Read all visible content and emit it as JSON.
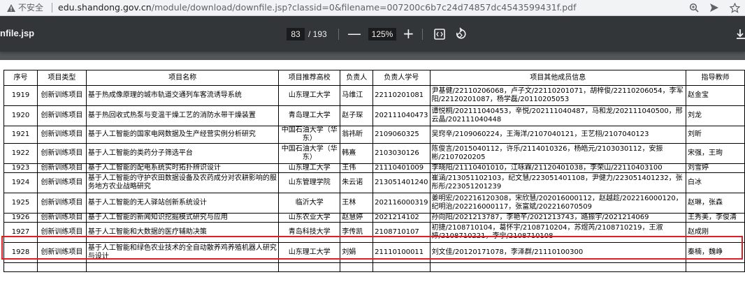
{
  "browser": {
    "security_label": "不安全",
    "url_host": "edu.shandong.gov.cn",
    "url_path": "/module/download/downfile.jsp?classid=0&filename=007200c6b7c24d74857dc4543599431f.pdf",
    "icons": [
      "warning-icon",
      "zoom-icon",
      "share-icon",
      "star-icon"
    ]
  },
  "pdf_toolbar": {
    "title": "nfile.jsp",
    "current_page": "83",
    "total_pages": "/ 193",
    "zoom": "125%",
    "minus": "—",
    "plus": "+",
    "icons": [
      "fit-page-icon",
      "rotate-icon",
      "download-icon"
    ]
  },
  "table": {
    "headers": [
      "序号",
      "项目类型",
      "项目名称",
      "项目推荐高校",
      "负责人",
      "负责人学号",
      "项目其他成员信息",
      "指导教师"
    ],
    "rows": [
      {
        "no": "1919",
        "type": "创新训练项目",
        "name": "基于热成像原理的城市轨道交通列车客流诱导系统",
        "school": "山东理工大学",
        "leader": "马维江",
        "sid": "22110201081",
        "members": "尹基健/22110206068，卢子文/22110201071，胡梓俊/22110206054，李军阳/22120201087，杨学磊/20110205053",
        "advisor": "赵金宝"
      },
      {
        "no": "1920",
        "type": "创新训练项目",
        "name": "基于热回收式热泵与变温干燥工艺的消防水带干燥装置",
        "school": "青岛理工大学",
        "leader": "赵子琛",
        "sid": "202111040473",
        "members": "谭悦桐/202111040453，辛悦/202111040487，马和龙/202111040500，邢云晶/202111040448",
        "advisor": "刘龙"
      },
      {
        "no": "1921",
        "type": "创新训练项目",
        "name": "基于人工智能的国家电网数据及生产经营实例分析研究",
        "school": "中国石油大学（华东）",
        "leader": "翁祎昕",
        "sid": "2109060325",
        "members": "吴窍辛/2109060224，王海洋/2107040121，王艺栩/2107040123",
        "advisor": "刘昕"
      },
      {
        "no": "1922",
        "type": "创新训练项目",
        "name": "基于人工智能的类药分子筛选平台",
        "school": "中国石油大学（华东）",
        "leader": "韩熹",
        "sid": "2103030126",
        "members": "陈俊言/2015040112，许乐/2114010326，杨皓元/2103030112，安振彬/2107020205",
        "advisor": "宋强，王珣"
      },
      {
        "no": "1923",
        "type": "创新训练项目",
        "name": "基于人工智能的配电系统实时拓扑辨识设计",
        "school": "山东理工大学",
        "leader": "王伟",
        "sid": "21110401009",
        "members": "李晓阳/21110401010，江咏霖/21120401038，李荣山/22110403100",
        "advisor": "刘雪婷"
      },
      {
        "no": "1924",
        "type": "创新训练项目",
        "name": "基于人工智能的守护农田数据设备及农药成分对农耕影响的服务地方农业战略研究",
        "school": "山东管理学院",
        "leader": "朱云诺",
        "sid": "213051401240",
        "members": "崔涵/213051102103，纪文慧/223051401108，尹健力/223051401232，张彤彤/223051201239",
        "advisor": "白冰"
      },
      {
        "no": "1925",
        "type": "创新训练项目",
        "name": "基于人工智能的无人驿站创新系统设计",
        "school": "临沂大学",
        "leader": "王林",
        "sid": "202116000319",
        "members": "姜明宏/202216120308，宋欣慧/202016000112，赵越趁/202216000120，纪明治/202216000117，张富斌/202216070509",
        "advisor": "赵琳，张森"
      },
      {
        "no": "1926",
        "type": "创新训练项目",
        "name": "基于人工智能的新闻知识挖掘模式研究与应用",
        "school": "山东农业大学",
        "leader": "赵慧婷",
        "sid": "2021214102",
        "members": "孙向阳/2021213787，李艳芊/2021213743，路振宇/2021214069",
        "advisor": "王秀美，李俊清"
      },
      {
        "no": "1927",
        "type": "创新训练项目",
        "name": "基于人工智能和大数据的医疗辅助决策",
        "school": "青岛科技大学",
        "leader": "李传凯",
        "sid": "2108710107",
        "members": "初捷/2108710104，葛怀宇/2108710204，苏煜芮/2108710219，王淑婷/2108710221，李宁/2108710108",
        "advisor": "赵成刚"
      },
      {
        "no": "1928",
        "type": "创新训练项目",
        "name": "基于人工智能和绿色农业技术的全自动散养鸡养殖机器人研究与设计",
        "school": "山东理工大学",
        "leader": "刘娟",
        "sid": "21110100011",
        "members": "刘文佳/20120171078，李泽群/21110100300",
        "advisor": "秦楠，魏峥"
      },
      {
        "no": "",
        "type": "",
        "name": "",
        "school": "",
        "leader": "",
        "sid": "",
        "members": "",
        "advisor": ""
      }
    ]
  },
  "highlight_color": "#e02020"
}
